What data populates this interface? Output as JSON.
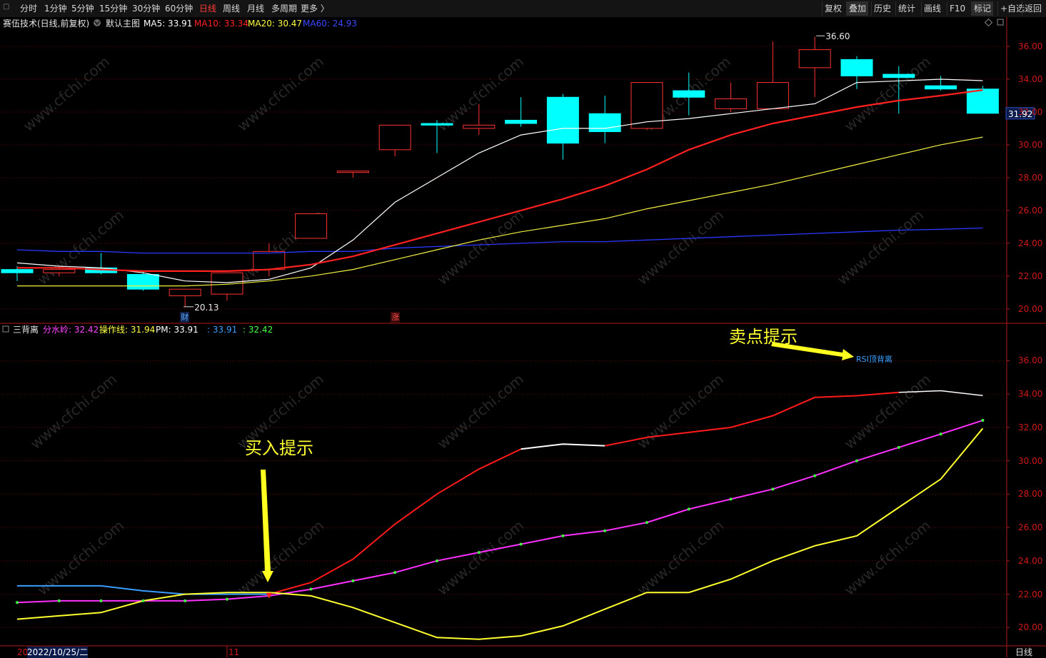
{
  "toolbar": {
    "left_items": [
      "分时",
      "1分钟",
      "5分钟",
      "15分钟",
      "30分钟",
      "60分钟",
      "日线",
      "周线",
      "月线",
      "多周期",
      "更多"
    ],
    "active_item": "日线",
    "more_chevron": "〉",
    "right_items": [
      "复权",
      "叠加",
      "历史",
      "统计",
      "画线",
      "F10",
      "标记",
      "+自选",
      "返回"
    ]
  },
  "main_panel": {
    "indicator_name": "赛伍技术",
    "indicator_params": "(日线,前复权)",
    "template_label": "默认主图",
    "ma": [
      {
        "label": "MA5: 33.91",
        "color": "#ffffff"
      },
      {
        "label": "MA10: 33.34",
        "color": "#ff2222"
      },
      {
        "label": "MA20: 30.47",
        "color": "#ffff44"
      },
      {
        "label": "MA60: 24.93",
        "color": "#3a48ff"
      }
    ],
    "y_ticks": [
      36.0,
      34.0,
      32.0,
      30.0,
      28.0,
      26.0,
      24.0,
      22.0,
      20.0
    ],
    "y_range": [
      19.6,
      37.0
    ],
    "last_price_label": "31.92",
    "high_label": "36.60",
    "low_label": "20.13",
    "marker_cai": "财",
    "marker_zhang": "涨"
  },
  "sub_panel": {
    "indicator_name": "三背离",
    "legend": [
      {
        "label": "分水岭: 32.42",
        "color": "#ff44ff"
      },
      {
        "label": "操作线: 31.94",
        "color": "#ffff44"
      },
      {
        "label": "PM: 33.91",
        "color": "#ffffff"
      },
      {
        "label": ": 33.91",
        "color": "#3aa0ff"
      },
      {
        "label": ": 32.42",
        "color": "#44ff44"
      }
    ],
    "y_ticks": [
      36.0,
      34.0,
      32.0,
      30.0,
      28.0,
      26.0,
      24.0,
      22.0,
      20.0
    ],
    "y_range": [
      19.2,
      37.6
    ],
    "buy_hint": "买入提示",
    "sell_hint": "卖点提示",
    "rsi_label": "RSI顶背离"
  },
  "x_axis": {
    "date_label": "2022/10/25/二",
    "month_label": "11",
    "left_label": "20",
    "period_label": "日线"
  },
  "watermark": "www.cfchi.com",
  "colors": {
    "up": "#ff3232",
    "down": "#00ffff",
    "ma5": "#ffffff",
    "ma10": "#ff2020",
    "ma20": "#f0f040",
    "ma60": "#2a38ff",
    "axis": "#b01818",
    "grid": "#5a0000",
    "pm": "#ff1a1a",
    "pm_flat": "#ffffff",
    "early": "#3a9cff",
    "fenshuiling": "#ff30ff",
    "caozuo": "#ffff30",
    "dot": "#40ff40",
    "arrow": "#ffff20"
  },
  "chart_data": [
    {
      "type": "candlestick",
      "candles": [
        {
          "o": 22.4,
          "h": 22.6,
          "l": 21.7,
          "c": 22.2
        },
        {
          "o": 22.2,
          "h": 22.6,
          "l": 22.0,
          "c": 22.4
        },
        {
          "o": 22.5,
          "h": 23.4,
          "l": 22.1,
          "c": 22.2
        },
        {
          "o": 22.1,
          "h": 22.3,
          "l": 21.1,
          "c": 21.2
        },
        {
          "o": 20.8,
          "h": 21.0,
          "l": 20.13,
          "c": 21.2
        },
        {
          "o": 20.9,
          "h": 22.2,
          "l": 20.5,
          "c": 22.2
        },
        {
          "o": 22.4,
          "h": 24.0,
          "l": 22.0,
          "c": 23.5
        },
        {
          "o": 24.3,
          "h": 25.8,
          "l": 24.3,
          "c": 25.8
        },
        {
          "o": 28.4,
          "h": 28.4,
          "l": 28.0,
          "c": 28.4
        },
        {
          "o": 29.7,
          "h": 31.2,
          "l": 29.3,
          "c": 31.2
        },
        {
          "o": 31.3,
          "h": 31.5,
          "l": 29.5,
          "c": 31.2
        },
        {
          "o": 31.0,
          "h": 32.5,
          "l": 30.6,
          "c": 31.2
        },
        {
          "o": 31.5,
          "h": 32.9,
          "l": 31.1,
          "c": 31.3
        },
        {
          "o": 32.9,
          "h": 33.1,
          "l": 29.1,
          "c": 30.1
        },
        {
          "o": 31.9,
          "h": 33.0,
          "l": 30.1,
          "c": 30.8
        },
        {
          "o": 31.0,
          "h": 33.8,
          "l": 30.9,
          "c": 33.8
        },
        {
          "o": 33.3,
          "h": 34.4,
          "l": 31.8,
          "c": 32.9
        },
        {
          "o": 32.2,
          "h": 33.8,
          "l": 32.0,
          "c": 32.8
        },
        {
          "o": 32.2,
          "h": 36.3,
          "l": 32.2,
          "c": 33.8
        },
        {
          "o": 34.7,
          "h": 36.6,
          "l": 32.9,
          "c": 35.8
        },
        {
          "o": 35.2,
          "h": 35.4,
          "l": 33.4,
          "c": 34.2
        },
        {
          "o": 34.3,
          "h": 34.8,
          "l": 31.9,
          "c": 34.1
        },
        {
          "o": 33.6,
          "h": 34.2,
          "l": 33.3,
          "c": 33.4
        },
        {
          "o": 33.4,
          "h": 33.6,
          "l": 31.9,
          "c": 31.92
        }
      ],
      "ma5": [
        22.8,
        22.6,
        22.5,
        22.2,
        21.7,
        21.6,
        21.8,
        22.5,
        24.2,
        26.5,
        28.0,
        29.5,
        30.6,
        31.0,
        31.0,
        31.4,
        31.6,
        31.9,
        32.2,
        32.5,
        33.8,
        33.9,
        34.0,
        33.91
      ],
      "ma10": [
        22.5,
        22.5,
        22.4,
        22.3,
        22.3,
        22.3,
        22.4,
        22.7,
        23.2,
        23.9,
        24.6,
        25.3,
        26.0,
        26.7,
        27.5,
        28.5,
        29.7,
        30.6,
        31.3,
        31.8,
        32.3,
        32.7,
        33.0,
        33.34
      ],
      "ma20": [
        21.4,
        21.4,
        21.4,
        21.4,
        21.4,
        21.5,
        21.7,
        22.0,
        22.4,
        23.0,
        23.6,
        24.2,
        24.7,
        25.1,
        25.5,
        26.1,
        26.6,
        27.1,
        27.6,
        28.2,
        28.8,
        29.4,
        30.0,
        30.47
      ],
      "ma60": [
        23.6,
        23.5,
        23.5,
        23.4,
        23.4,
        23.4,
        23.4,
        23.5,
        23.5,
        23.7,
        23.8,
        23.9,
        24.0,
        24.1,
        24.1,
        24.2,
        24.3,
        24.4,
        24.5,
        24.6,
        24.7,
        24.8,
        24.85,
        24.93
      ]
    },
    {
      "type": "line",
      "series": [
        {
          "name": "PM",
          "values": [
            22.5,
            22.5,
            22.5,
            22.2,
            22.0,
            22.0,
            22.0,
            22.7,
            24.1,
            26.2,
            28.0,
            29.5,
            30.7,
            31.0,
            30.9,
            31.4,
            31.7,
            32.0,
            32.7,
            33.8,
            33.9,
            34.1,
            34.2,
            33.91
          ]
        },
        {
          "name": "分水岭",
          "values": [
            21.5,
            21.6,
            21.6,
            21.6,
            21.6,
            21.7,
            21.9,
            22.3,
            22.8,
            23.3,
            24.0,
            24.5,
            25.0,
            25.5,
            25.8,
            26.3,
            27.1,
            27.7,
            28.3,
            29.1,
            30.0,
            30.8,
            31.6,
            32.42
          ]
        },
        {
          "name": "操作线",
          "values": [
            20.5,
            20.7,
            20.9,
            21.6,
            22.0,
            22.1,
            22.1,
            21.9,
            21.2,
            20.3,
            19.4,
            19.3,
            19.5,
            20.1,
            21.1,
            22.1,
            22.1,
            22.9,
            24.0,
            24.9,
            25.5,
            27.2,
            28.9,
            31.94
          ]
        }
      ]
    }
  ]
}
